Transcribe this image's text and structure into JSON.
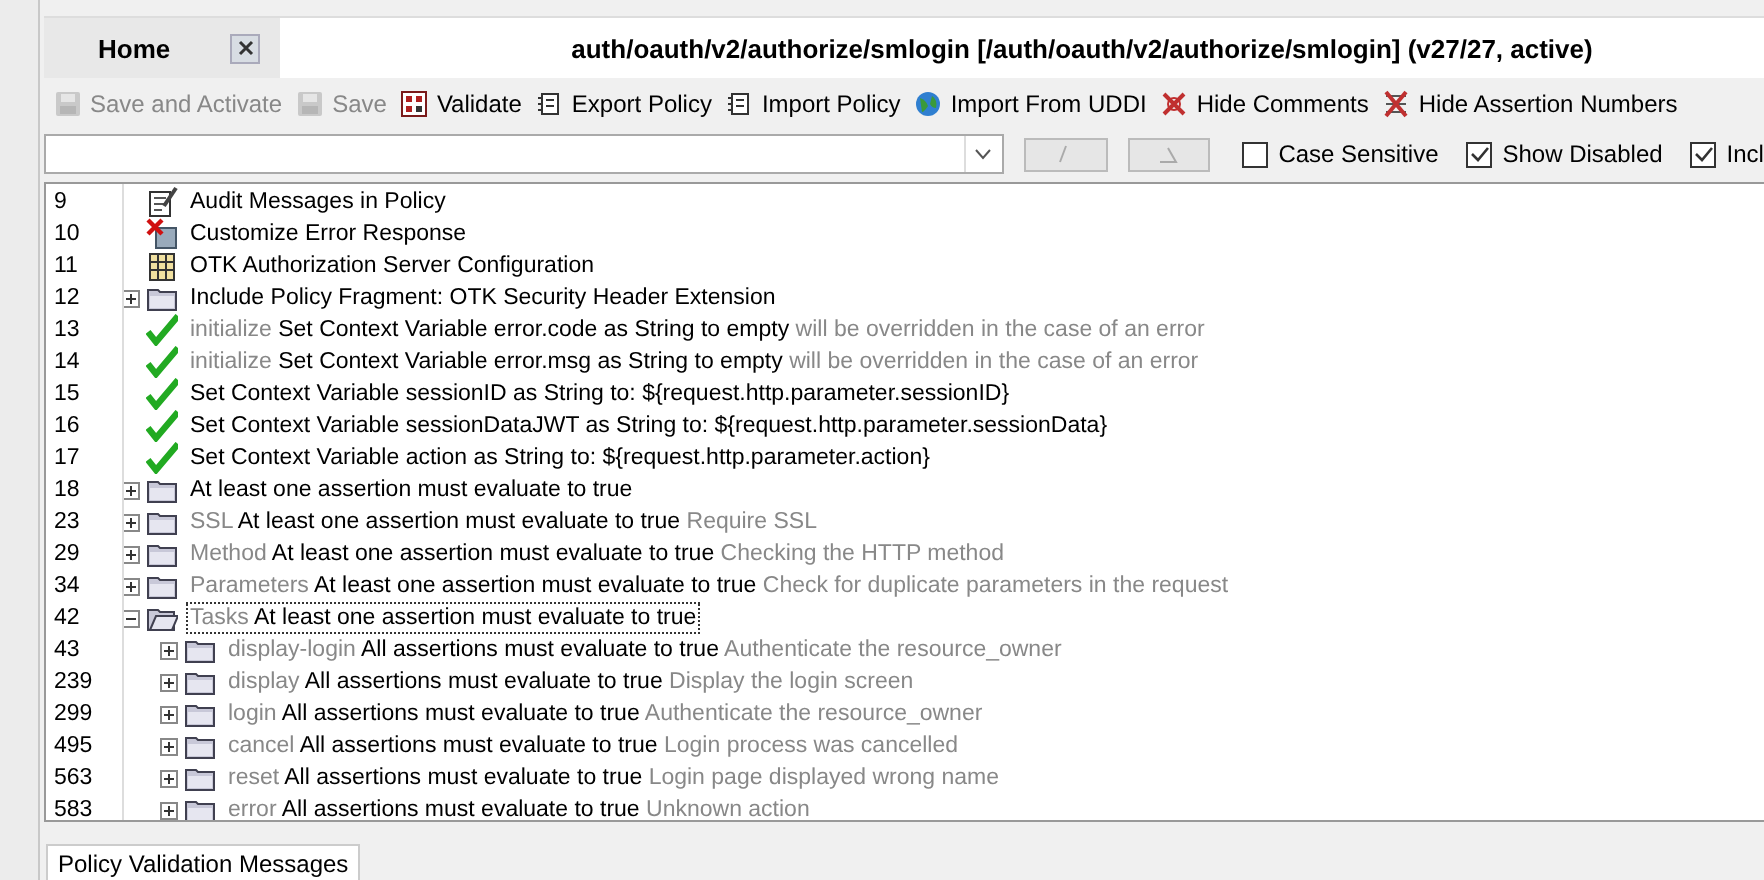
{
  "tabs": [
    {
      "label": "Home",
      "selected": false,
      "kind": "closable"
    },
    {
      "label": "auth/oauth/v2/authorize/smlogin [/auth/oauth/v2/authorize/smlogin] (v27/27, active)",
      "selected": true,
      "kind": "plain"
    }
  ],
  "toolbar": [
    {
      "label": "Save and Activate",
      "kind": "disk",
      "disabled": true
    },
    {
      "label": "Save",
      "kind": "disk",
      "disabled": true
    },
    {
      "label": "Validate",
      "kind": "grid",
      "disabled": false
    },
    {
      "label": "Export Policy",
      "kind": "doc",
      "disabled": false
    },
    {
      "label": "Import Policy",
      "kind": "doc",
      "disabled": false
    },
    {
      "label": "Import From UDDI",
      "kind": "globe",
      "disabled": false
    },
    {
      "label": "Hide Comments",
      "kind": "cross",
      "disabled": false
    },
    {
      "label": "Hide Assertion Numbers",
      "kind": "crosslist",
      "disabled": false
    }
  ],
  "search": {
    "buttons": [
      {
        "kind": "slash",
        "disabled": true
      },
      {
        "kind": "corner",
        "disabled": true
      }
    ],
    "options": [
      {
        "label": "Case Sensitive",
        "checked": false
      },
      {
        "label": "Show Disabled",
        "checked": true
      },
      {
        "label": "Incl",
        "checked": true
      }
    ]
  },
  "tree": [
    {
      "line": "9",
      "kind": "audit",
      "selected": false,
      "text": "Audit Messages in Policy"
    },
    {
      "line": "10",
      "kind": "error",
      "selected": false,
      "text": "Customize Error Response"
    },
    {
      "line": "11",
      "kind": "config",
      "selected": false,
      "text": "OTK Authorization Server Configuration"
    },
    {
      "line": "12",
      "kind": "folder",
      "expanded": false,
      "selected": false,
      "text": "Include Policy Fragment: OTK Security Header Extension"
    },
    {
      "line": "13",
      "kind": "check",
      "selected": false,
      "prefix": "initialize",
      "text": "Set Context Variable error.code as String to empty",
      "comment": "will be overridden in the case of an error"
    },
    {
      "line": "14",
      "kind": "check",
      "selected": false,
      "prefix": "initialize",
      "text": "Set Context Variable error.msg as String to empty",
      "comment": "will be overridden in the case of an error"
    },
    {
      "line": "15",
      "kind": "check",
      "selected": false,
      "text": "Set Context Variable sessionID as String to: ${request.http.parameter.sessionID}"
    },
    {
      "line": "16",
      "kind": "check",
      "selected": false,
      "text": "Set Context Variable sessionDataJWT as String to: ${request.http.parameter.sessionData}"
    },
    {
      "line": "17",
      "kind": "check",
      "selected": false,
      "text": "Set Context Variable action as String to: ${request.http.parameter.action}"
    },
    {
      "line": "18",
      "kind": "folder",
      "expanded": false,
      "selected": false,
      "text": "At least one assertion must evaluate to true"
    },
    {
      "line": "23",
      "kind": "folder",
      "expanded": false,
      "selected": false,
      "prefix": "SSL",
      "text": "At least one assertion must evaluate to true",
      "comment": "Require SSL"
    },
    {
      "line": "29",
      "kind": "folder",
      "expanded": false,
      "selected": false,
      "prefix": "Method",
      "text": "At least one assertion must evaluate to true",
      "comment": "Checking the HTTP method"
    },
    {
      "line": "34",
      "kind": "folder",
      "expanded": false,
      "selected": false,
      "prefix": "Parameters",
      "text": "At least one assertion must evaluate to true",
      "comment": "Check for duplicate parameters in the request"
    },
    {
      "line": "42",
      "kind": "folder",
      "expanded": true,
      "selected": true,
      "prefix": "Tasks",
      "text": "At least one assertion must evaluate to true",
      "children": [
        {
          "line": "43",
          "kind": "folder",
          "expanded": false,
          "selected": false,
          "prefix": "display-login",
          "text": "All assertions must evaluate to true",
          "comment": "Authenticate the resource_owner"
        },
        {
          "line": "239",
          "kind": "folder",
          "expanded": false,
          "selected": false,
          "prefix": "display",
          "text": "All assertions must evaluate to true",
          "comment": "Display the login screen"
        },
        {
          "line": "299",
          "kind": "folder",
          "expanded": false,
          "selected": false,
          "prefix": "login",
          "text": "All assertions must evaluate to true",
          "comment": "Authenticate the resource_owner"
        },
        {
          "line": "495",
          "kind": "folder",
          "expanded": false,
          "selected": false,
          "prefix": "cancel",
          "text": "All assertions must evaluate to true",
          "comment": "Login process was cancelled"
        },
        {
          "line": "563",
          "kind": "folder",
          "expanded": false,
          "selected": false,
          "prefix": "reset",
          "text": "All assertions must evaluate to true",
          "comment": "Login page displayed wrong name"
        },
        {
          "line": "583",
          "kind": "folder",
          "expanded": false,
          "selected": false,
          "prefix": "error",
          "text": "All assertions must evaluate to true",
          "comment": "Unknown action"
        }
      ]
    }
  ],
  "bottom_tabs": [
    {
      "label": "Policy Validation Messages",
      "selected": true
    }
  ]
}
